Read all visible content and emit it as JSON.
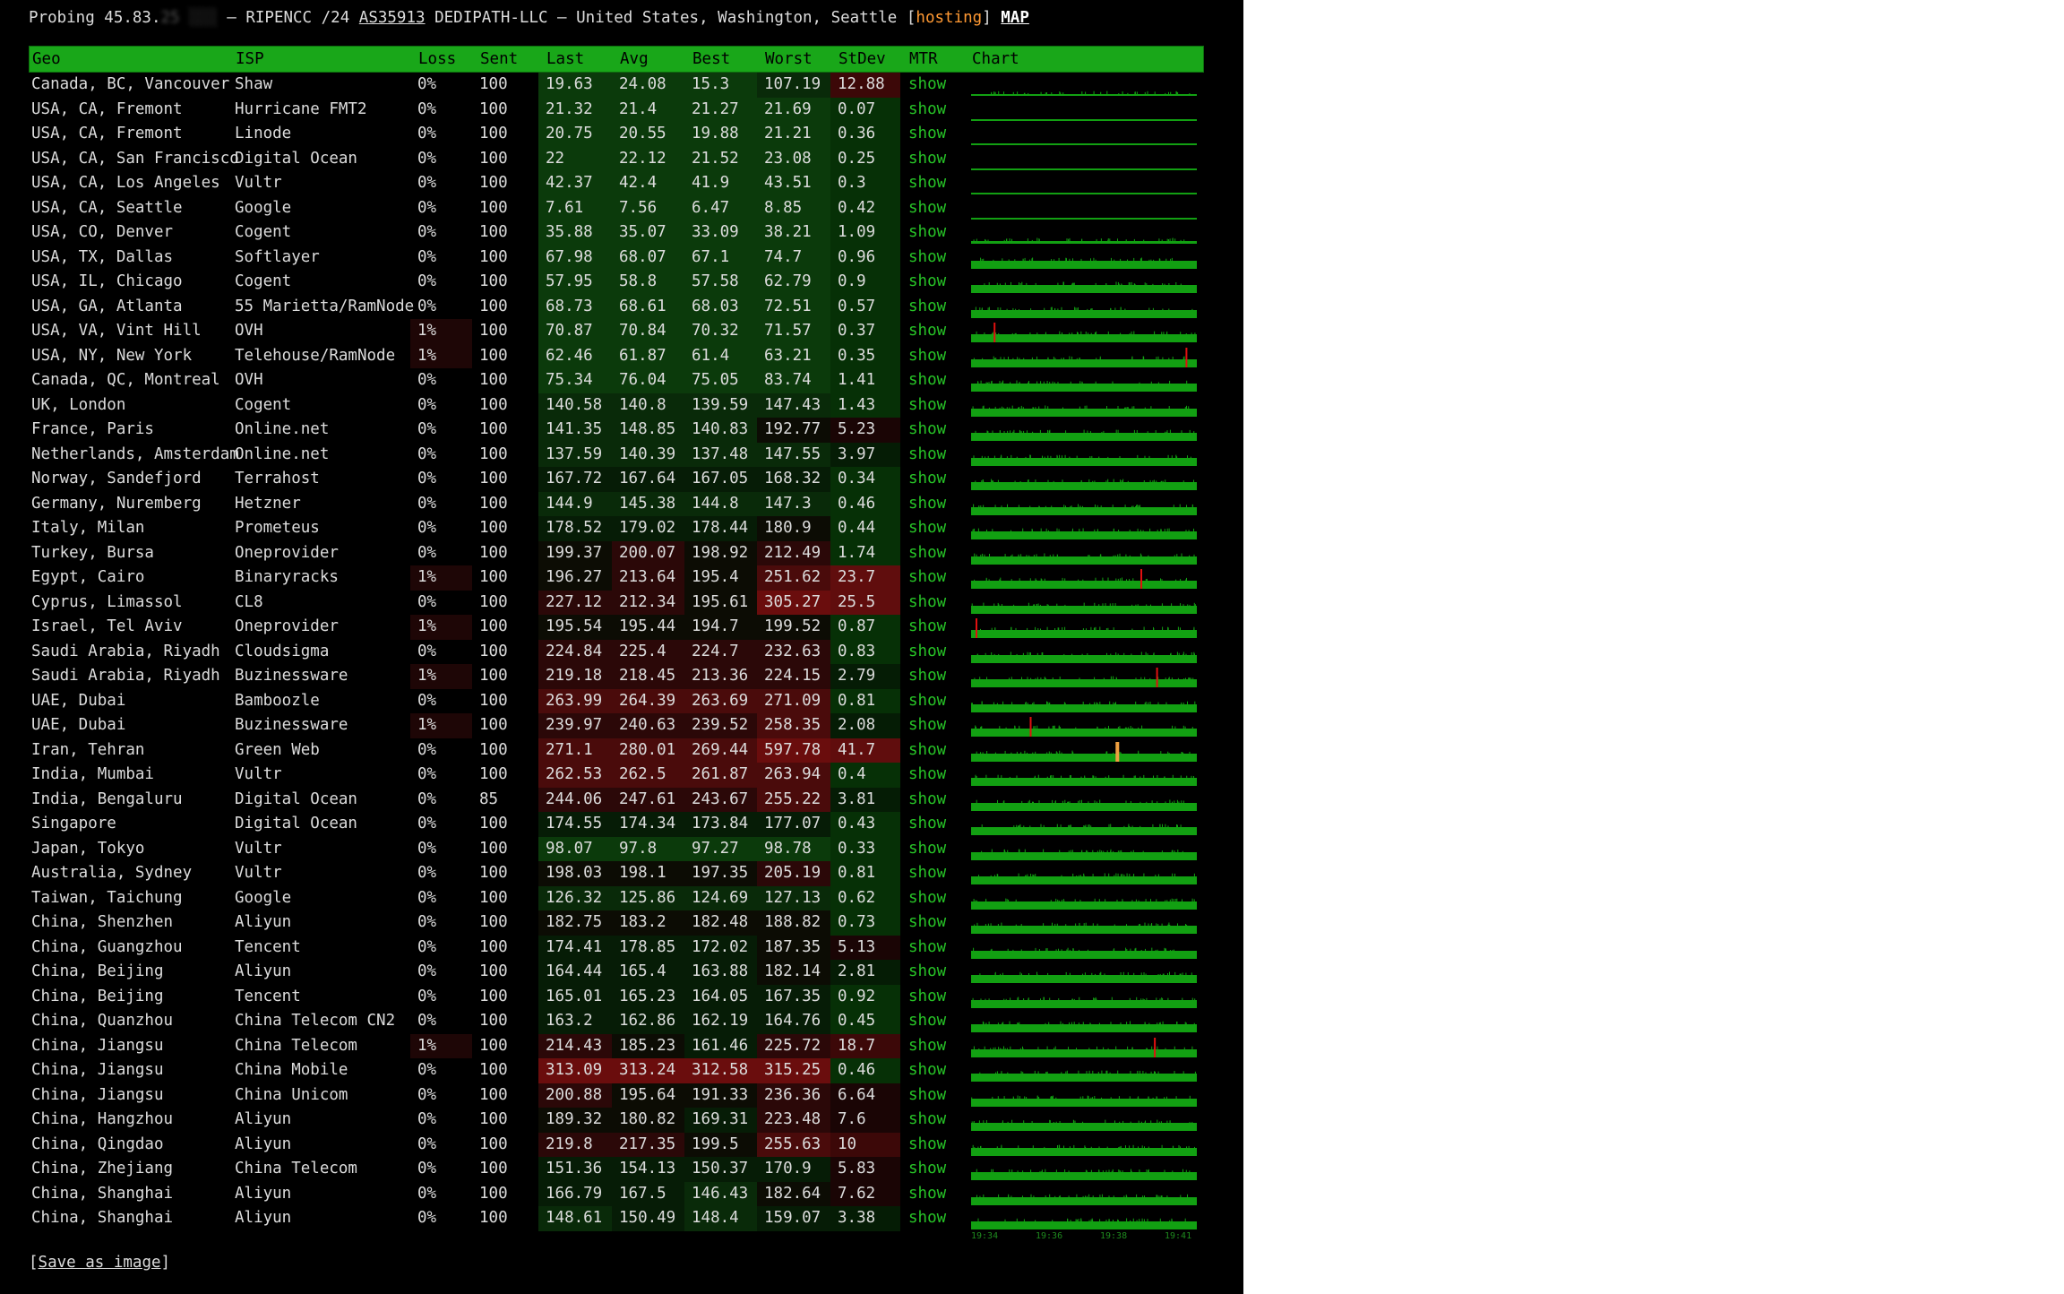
{
  "header": {
    "prefix": "Probing 45.83.",
    "ip_hidden": "25 ░░░",
    "sep": " – RIPENCC /24 ",
    "asn": "AS35913",
    "middle": " DEDIPATH-LLC – United States, Washington, Seattle [",
    "hosting": "hosting",
    "close": "] ",
    "map": "MAP"
  },
  "columns": [
    "Geo",
    "ISP",
    "Loss",
    "Sent",
    "Last",
    "Avg",
    "Best",
    "Worst",
    "StDev",
    "MTR",
    "Chart"
  ],
  "rows": [
    {
      "geo": "Canada, BC, Vancouver",
      "isp": "Shaw",
      "loss": "0%",
      "sent": "100",
      "last": "19.63",
      "avg": "24.08",
      "best": "15.3",
      "worst": "107.19",
      "stdev": "12.88",
      "mtr": "show",
      "chart": "sparse",
      "spikes": []
    },
    {
      "geo": "USA, CA, Fremont",
      "isp": "Hurricane FMT2",
      "loss": "0%",
      "sent": "100",
      "last": "21.32",
      "avg": "21.4",
      "best": "21.27",
      "worst": "21.69",
      "stdev": "0.07",
      "mtr": "show",
      "chart": "line",
      "spikes": []
    },
    {
      "geo": "USA, CA, Fremont",
      "isp": "Linode",
      "loss": "0%",
      "sent": "100",
      "last": "20.75",
      "avg": "20.55",
      "best": "19.88",
      "worst": "21.21",
      "stdev": "0.36",
      "mtr": "show",
      "chart": "line",
      "spikes": []
    },
    {
      "geo": "USA, CA, San Francisco",
      "isp": "Digital Ocean",
      "loss": "0%",
      "sent": "100",
      "last": "22",
      "avg": "22.12",
      "best": "21.52",
      "worst": "23.08",
      "stdev": "0.25",
      "mtr": "show",
      "chart": "line",
      "spikes": []
    },
    {
      "geo": "USA, CA, Los Angeles",
      "isp": "Vultr",
      "loss": "0%",
      "sent": "100",
      "last": "42.37",
      "avg": "42.4",
      "best": "41.9",
      "worst": "43.51",
      "stdev": "0.3",
      "mtr": "show",
      "chart": "line",
      "spikes": []
    },
    {
      "geo": "USA, CA, Seattle",
      "isp": "Google",
      "loss": "0%",
      "sent": "100",
      "last": "7.61",
      "avg": "7.56",
      "best": "6.47",
      "worst": "8.85",
      "stdev": "0.42",
      "mtr": "show",
      "chart": "line",
      "spikes": []
    },
    {
      "geo": "USA, CO, Denver",
      "isp": "Cogent",
      "loss": "0%",
      "sent": "100",
      "last": "35.88",
      "avg": "35.07",
      "best": "33.09",
      "worst": "38.21",
      "stdev": "1.09",
      "mtr": "show",
      "chart": "thin",
      "spikes": []
    },
    {
      "geo": "USA, TX, Dallas",
      "isp": "Softlayer",
      "loss": "0%",
      "sent": "100",
      "last": "67.98",
      "avg": "68.07",
      "best": "67.1",
      "worst": "74.7",
      "stdev": "0.96",
      "mtr": "show",
      "chart": "bar",
      "spikes": []
    },
    {
      "geo": "USA, IL, Chicago",
      "isp": "Cogent",
      "loss": "0%",
      "sent": "100",
      "last": "57.95",
      "avg": "58.8",
      "best": "57.58",
      "worst": "62.79",
      "stdev": "0.9",
      "mtr": "show",
      "chart": "bar",
      "spikes": []
    },
    {
      "geo": "USA, GA, Atlanta",
      "isp": "55 Marietta/RamNode",
      "loss": "0%",
      "sent": "100",
      "last": "68.73",
      "avg": "68.61",
      "best": "68.03",
      "worst": "72.51",
      "stdev": "0.57",
      "mtr": "show",
      "chart": "bar",
      "spikes": []
    },
    {
      "geo": "USA, VA, Vint Hill",
      "isp": "OVH",
      "loss": "1%",
      "sent": "100",
      "last": "70.87",
      "avg": "70.84",
      "best": "70.32",
      "worst": "71.57",
      "stdev": "0.37",
      "mtr": "show",
      "chart": "bar",
      "spikes": [
        {
          "pos": 0.1,
          "color": "#e01010"
        }
      ]
    },
    {
      "geo": "USA, NY, New York",
      "isp": "Telehouse/RamNode",
      "loss": "1%",
      "sent": "100",
      "last": "62.46",
      "avg": "61.87",
      "best": "61.4",
      "worst": "63.21",
      "stdev": "0.35",
      "mtr": "show",
      "chart": "bar",
      "spikes": [
        {
          "pos": 0.95,
          "color": "#e01010"
        }
      ]
    },
    {
      "geo": "Canada, QC, Montreal",
      "isp": "OVH",
      "loss": "0%",
      "sent": "100",
      "last": "75.34",
      "avg": "76.04",
      "best": "75.05",
      "worst": "83.74",
      "stdev": "1.41",
      "mtr": "show",
      "chart": "bar",
      "spikes": []
    },
    {
      "geo": "UK, London",
      "isp": "Cogent",
      "loss": "0%",
      "sent": "100",
      "last": "140.58",
      "avg": "140.8",
      "best": "139.59",
      "worst": "147.43",
      "stdev": "1.43",
      "mtr": "show",
      "chart": "bar",
      "spikes": []
    },
    {
      "geo": "France, Paris",
      "isp": "Online.net",
      "loss": "0%",
      "sent": "100",
      "last": "141.35",
      "avg": "148.85",
      "best": "140.83",
      "worst": "192.77",
      "stdev": "5.23",
      "mtr": "show",
      "chart": "bar",
      "spikes": []
    },
    {
      "geo": "Netherlands, Amsterdam",
      "isp": "Online.net",
      "loss": "0%",
      "sent": "100",
      "last": "137.59",
      "avg": "140.39",
      "best": "137.48",
      "worst": "147.55",
      "stdev": "3.97",
      "mtr": "show",
      "chart": "bar",
      "spikes": []
    },
    {
      "geo": "Norway, Sandefjord",
      "isp": "Terrahost",
      "loss": "0%",
      "sent": "100",
      "last": "167.72",
      "avg": "167.64",
      "best": "167.05",
      "worst": "168.32",
      "stdev": "0.34",
      "mtr": "show",
      "chart": "bar",
      "spikes": []
    },
    {
      "geo": "Germany, Nuremberg",
      "isp": "Hetzner",
      "loss": "0%",
      "sent": "100",
      "last": "144.9",
      "avg": "145.38",
      "best": "144.8",
      "worst": "147.3",
      "stdev": "0.46",
      "mtr": "show",
      "chart": "bar",
      "spikes": []
    },
    {
      "geo": "Italy, Milan",
      "isp": "Prometeus",
      "loss": "0%",
      "sent": "100",
      "last": "178.52",
      "avg": "179.02",
      "best": "178.44",
      "worst": "180.9",
      "stdev": "0.44",
      "mtr": "show",
      "chart": "bar",
      "spikes": []
    },
    {
      "geo": "Turkey, Bursa",
      "isp": "Oneprovider",
      "loss": "0%",
      "sent": "100",
      "last": "199.37",
      "avg": "200.07",
      "best": "198.92",
      "worst": "212.49",
      "stdev": "1.74",
      "mtr": "show",
      "chart": "bar",
      "spikes": []
    },
    {
      "geo": "Egypt, Cairo",
      "isp": "Binaryracks",
      "loss": "1%",
      "sent": "100",
      "last": "196.27",
      "avg": "213.64",
      "best": "195.4",
      "worst": "251.62",
      "stdev": "23.7",
      "mtr": "show",
      "chart": "bar",
      "spikes": [
        {
          "pos": 0.75,
          "color": "#e01010"
        }
      ]
    },
    {
      "geo": "Cyprus, Limassol",
      "isp": "CL8",
      "loss": "0%",
      "sent": "100",
      "last": "227.12",
      "avg": "212.34",
      "best": "195.61",
      "worst": "305.27",
      "stdev": "25.5",
      "mtr": "show",
      "chart": "bar",
      "spikes": []
    },
    {
      "geo": "Israel, Tel Aviv",
      "isp": "Oneprovider",
      "loss": "1%",
      "sent": "100",
      "last": "195.54",
      "avg": "195.44",
      "best": "194.7",
      "worst": "199.52",
      "stdev": "0.87",
      "mtr": "show",
      "chart": "bar",
      "spikes": [
        {
          "pos": 0.02,
          "color": "#e01010"
        }
      ]
    },
    {
      "geo": "Saudi Arabia, Riyadh",
      "isp": "Cloudsigma",
      "loss": "0%",
      "sent": "100",
      "last": "224.84",
      "avg": "225.4",
      "best": "224.7",
      "worst": "232.63",
      "stdev": "0.83",
      "mtr": "show",
      "chart": "bar",
      "spikes": []
    },
    {
      "geo": "Saudi Arabia, Riyadh",
      "isp": "Buzinessware",
      "loss": "1%",
      "sent": "100",
      "last": "219.18",
      "avg": "218.45",
      "best": "213.36",
      "worst": "224.15",
      "stdev": "2.79",
      "mtr": "show",
      "chart": "bar",
      "spikes": [
        {
          "pos": 0.82,
          "color": "#e01010"
        }
      ]
    },
    {
      "geo": "UAE, Dubai",
      "isp": "Bamboozle",
      "loss": "0%",
      "sent": "100",
      "last": "263.99",
      "avg": "264.39",
      "best": "263.69",
      "worst": "271.09",
      "stdev": "0.81",
      "mtr": "show",
      "chart": "bar",
      "spikes": []
    },
    {
      "geo": "UAE, Dubai",
      "isp": "Buzinessware",
      "loss": "1%",
      "sent": "100",
      "last": "239.97",
      "avg": "240.63",
      "best": "239.52",
      "worst": "258.35",
      "stdev": "2.08",
      "mtr": "show",
      "chart": "bar",
      "spikes": [
        {
          "pos": 0.26,
          "color": "#e01010"
        }
      ]
    },
    {
      "geo": "Iran, Tehran",
      "isp": "Green Web",
      "loss": "0%",
      "sent": "100",
      "last": "271.1",
      "avg": "280.01",
      "best": "269.44",
      "worst": "597.78",
      "stdev": "41.7",
      "mtr": "show",
      "chart": "bar",
      "spikes": [
        {
          "pos": 0.64,
          "color": "#f0a040"
        }
      ]
    },
    {
      "geo": "India, Mumbai",
      "isp": "Vultr",
      "loss": "0%",
      "sent": "100",
      "last": "262.53",
      "avg": "262.5",
      "best": "261.87",
      "worst": "263.94",
      "stdev": "0.4",
      "mtr": "show",
      "chart": "bar",
      "spikes": []
    },
    {
      "geo": "India, Bengaluru",
      "isp": "Digital Ocean",
      "loss": "0%",
      "sent": "85",
      "last": "244.06",
      "avg": "247.61",
      "best": "243.67",
      "worst": "255.22",
      "stdev": "3.81",
      "mtr": "show",
      "chart": "bar",
      "spikes": []
    },
    {
      "geo": "Singapore",
      "isp": "Digital Ocean",
      "loss": "0%",
      "sent": "100",
      "last": "174.55",
      "avg": "174.34",
      "best": "173.84",
      "worst": "177.07",
      "stdev": "0.43",
      "mtr": "show",
      "chart": "bar",
      "spikes": []
    },
    {
      "geo": "Japan, Tokyo",
      "isp": "Vultr",
      "loss": "0%",
      "sent": "100",
      "last": "98.07",
      "avg": "97.8",
      "best": "97.27",
      "worst": "98.78",
      "stdev": "0.33",
      "mtr": "show",
      "chart": "bar",
      "spikes": []
    },
    {
      "geo": "Australia, Sydney",
      "isp": "Vultr",
      "loss": "0%",
      "sent": "100",
      "last": "198.03",
      "avg": "198.1",
      "best": "197.35",
      "worst": "205.19",
      "stdev": "0.81",
      "mtr": "show",
      "chart": "bar",
      "spikes": []
    },
    {
      "geo": "Taiwan, Taichung",
      "isp": "Google",
      "loss": "0%",
      "sent": "100",
      "last": "126.32",
      "avg": "125.86",
      "best": "124.69",
      "worst": "127.13",
      "stdev": "0.62",
      "mtr": "show",
      "chart": "bar",
      "spikes": []
    },
    {
      "geo": "China, Shenzhen",
      "isp": "Aliyun",
      "loss": "0%",
      "sent": "100",
      "last": "182.75",
      "avg": "183.2",
      "best": "182.48",
      "worst": "188.82",
      "stdev": "0.73",
      "mtr": "show",
      "chart": "bar",
      "spikes": []
    },
    {
      "geo": "China, Guangzhou",
      "isp": "Tencent",
      "loss": "0%",
      "sent": "100",
      "last": "174.41",
      "avg": "178.85",
      "best": "172.02",
      "worst": "187.35",
      "stdev": "5.13",
      "mtr": "show",
      "chart": "bar",
      "spikes": []
    },
    {
      "geo": "China, Beijing",
      "isp": "Aliyun",
      "loss": "0%",
      "sent": "100",
      "last": "164.44",
      "avg": "165.4",
      "best": "163.88",
      "worst": "182.14",
      "stdev": "2.81",
      "mtr": "show",
      "chart": "bar",
      "spikes": []
    },
    {
      "geo": "China, Beijing",
      "isp": "Tencent",
      "loss": "0%",
      "sent": "100",
      "last": "165.01",
      "avg": "165.23",
      "best": "164.05",
      "worst": "167.35",
      "stdev": "0.92",
      "mtr": "show",
      "chart": "bar",
      "spikes": []
    },
    {
      "geo": "China, Quanzhou",
      "isp": "China Telecom CN2",
      "loss": "0%",
      "sent": "100",
      "last": "163.2",
      "avg": "162.86",
      "best": "162.19",
      "worst": "164.76",
      "stdev": "0.45",
      "mtr": "show",
      "chart": "bar",
      "spikes": []
    },
    {
      "geo": "China, Jiangsu",
      "isp": "China Telecom",
      "loss": "1%",
      "sent": "100",
      "last": "214.43",
      "avg": "185.23",
      "best": "161.46",
      "worst": "225.72",
      "stdev": "18.7",
      "mtr": "show",
      "chart": "bar",
      "spikes": [
        {
          "pos": 0.81,
          "color": "#e01010"
        }
      ]
    },
    {
      "geo": "China, Jiangsu",
      "isp": "China Mobile",
      "loss": "0%",
      "sent": "100",
      "last": "313.09",
      "avg": "313.24",
      "best": "312.58",
      "worst": "315.25",
      "stdev": "0.46",
      "mtr": "show",
      "chart": "bar",
      "spikes": []
    },
    {
      "geo": "China, Jiangsu",
      "isp": "China Unicom",
      "loss": "0%",
      "sent": "100",
      "last": "200.88",
      "avg": "195.64",
      "best": "191.33",
      "worst": "236.36",
      "stdev": "6.64",
      "mtr": "show",
      "chart": "bar",
      "spikes": []
    },
    {
      "geo": "China, Hangzhou",
      "isp": "Aliyun",
      "loss": "0%",
      "sent": "100",
      "last": "189.32",
      "avg": "180.82",
      "best": "169.31",
      "worst": "223.48",
      "stdev": "7.6",
      "mtr": "show",
      "chart": "bar",
      "spikes": []
    },
    {
      "geo": "China, Qingdao",
      "isp": "Aliyun",
      "loss": "0%",
      "sent": "100",
      "last": "219.8",
      "avg": "217.35",
      "best": "199.5",
      "worst": "255.63",
      "stdev": "10",
      "mtr": "show",
      "chart": "bar",
      "spikes": []
    },
    {
      "geo": "China, Zhejiang",
      "isp": "China Telecom",
      "loss": "0%",
      "sent": "100",
      "last": "151.36",
      "avg": "154.13",
      "best": "150.37",
      "worst": "170.9",
      "stdev": "5.83",
      "mtr": "show",
      "chart": "bar",
      "spikes": []
    },
    {
      "geo": "China, Shanghai",
      "isp": "Aliyun",
      "loss": "0%",
      "sent": "100",
      "last": "166.79",
      "avg": "167.5",
      "best": "146.43",
      "worst": "182.64",
      "stdev": "7.62",
      "mtr": "show",
      "chart": "bar",
      "spikes": []
    },
    {
      "geo": "China, Shanghai",
      "isp": "Aliyun",
      "loss": "0%",
      "sent": "100",
      "last": "148.61",
      "avg": "150.49",
      "best": "148.4",
      "worst": "159.07",
      "stdev": "3.38",
      "mtr": "show",
      "chart": "bar",
      "spikes": []
    }
  ],
  "time_labels": [
    "19:34",
    "19:36",
    "19:38",
    "19:41"
  ],
  "save": {
    "open": "[",
    "label": "Save as image",
    "close": "]"
  }
}
